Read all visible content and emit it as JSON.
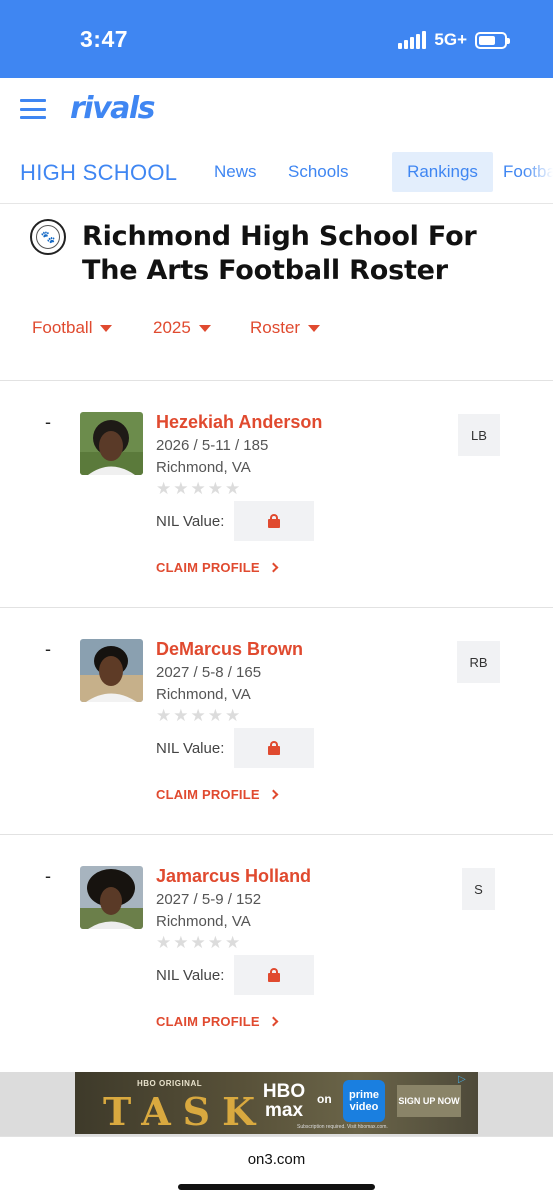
{
  "status_bar": {
    "time": "3:47",
    "network": "5G+"
  },
  "header": {
    "logo": "rivals",
    "menu_icon": "hamburger-menu-icon"
  },
  "nav": {
    "title": "HIGH SCHOOL",
    "items": [
      {
        "label": "News",
        "active": false
      },
      {
        "label": "Schools",
        "active": false
      },
      {
        "label": "Rankings",
        "active": true
      },
      {
        "label": "Football",
        "active": false
      }
    ]
  },
  "page": {
    "title": "Richmond High School For The Arts Football Roster",
    "school_logo_icon": "school-crest-icon"
  },
  "filters": {
    "sport": "Football",
    "year": "2025",
    "view": "Roster"
  },
  "roster": {
    "nil_label": "NIL Value:",
    "claim_label": "CLAIM PROFILE",
    "players": [
      {
        "rank": "-",
        "name": "Hezekiah Anderson",
        "meta": "2026 / 5-11 / 185",
        "hometown": "Richmond, VA",
        "position": "LB",
        "stars": 0
      },
      {
        "rank": "-",
        "name": "DeMarcus Brown",
        "meta": "2027 / 5-8 / 165",
        "hometown": "Richmond, VA",
        "position": "RB",
        "stars": 0
      },
      {
        "rank": "-",
        "name": "Jamarcus Holland",
        "meta": "2027 / 5-9 / 152",
        "hometown": "Richmond, VA",
        "position": "S",
        "stars": 0
      }
    ]
  },
  "ad": {
    "small": "HBO ORIGINAL",
    "title": "TASK",
    "brand": "HBO max",
    "on": "on",
    "partner": "prime video",
    "cta": "SIGN UP NOW",
    "fine": "Subscription required. Visit hbomax.com."
  },
  "browser": {
    "url": "on3.com"
  },
  "colors": {
    "brand_blue": "#3f86f2",
    "accent_red": "#e04a2f"
  }
}
